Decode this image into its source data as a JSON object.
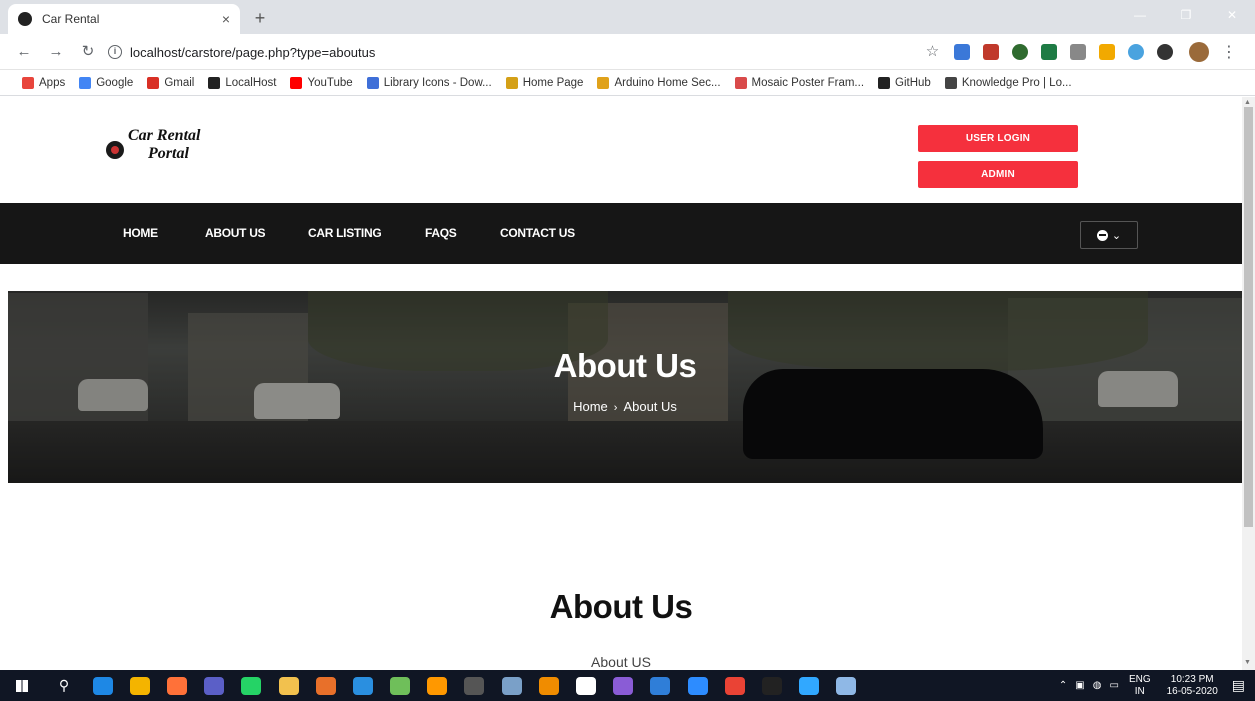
{
  "browser": {
    "tab_title": "Car Rental",
    "tab_close": "×",
    "new_tab": "+",
    "url": "localhost/carstore/page.php?type=aboutus",
    "bookmarks": [
      {
        "label": "Apps",
        "color": "#e8453c"
      },
      {
        "label": "Google",
        "color": "#4285f4"
      },
      {
        "label": "Gmail",
        "color": "#d93025"
      },
      {
        "label": "LocalHost",
        "color": "#222222"
      },
      {
        "label": "YouTube",
        "color": "#ff0000"
      },
      {
        "label": "Library Icons - Dow...",
        "color": "#3f6fd8"
      },
      {
        "label": "Home Page",
        "color": "#d4a017"
      },
      {
        "label": "Arduino Home Sec...",
        "color": "#e0a21b"
      },
      {
        "label": "Mosaic Poster Fram...",
        "color": "#d94a4a"
      },
      {
        "label": "GitHub",
        "color": "#222222"
      },
      {
        "label": "Knowledge Pro | Lo...",
        "color": "#444444"
      }
    ]
  },
  "site": {
    "logo_line1": "Car Rental",
    "logo_line2": "Portal",
    "user_login_label": "USER LOGIN",
    "admin_label": "ADMIN",
    "nav": {
      "home": "HOME",
      "about": "ABOUT US",
      "listing": "CAR LISTING",
      "faqs": "FAQS",
      "contact": "CONTACT US"
    },
    "user_menu_caret": "⌄"
  },
  "hero": {
    "title": "About Us",
    "crumb_home": "Home",
    "crumb_sep": "›",
    "crumb_current": "About Us"
  },
  "content": {
    "title": "About Us",
    "subtitle": "About US"
  },
  "taskbar": {
    "lang_top": "ENG",
    "lang_bottom": "IN",
    "time": "10:23 PM",
    "date": "16-05-2020",
    "apps": [
      {
        "name": "edge",
        "color": "#1e88e5"
      },
      {
        "name": "chrome",
        "color": "#f4b400"
      },
      {
        "name": "firefox",
        "color": "#ff7139"
      },
      {
        "name": "teams",
        "color": "#5b5fc7"
      },
      {
        "name": "whatsapp",
        "color": "#25d366"
      },
      {
        "name": "explorer",
        "color": "#f2c14e"
      },
      {
        "name": "app-orange",
        "color": "#e8702a"
      },
      {
        "name": "vscode",
        "color": "#2a8fe0"
      },
      {
        "name": "notepad",
        "color": "#6fbf5a"
      },
      {
        "name": "sublime",
        "color": "#ff9800"
      },
      {
        "name": "terminal",
        "color": "#555555"
      },
      {
        "name": "paint",
        "color": "#7aa0c8"
      },
      {
        "name": "app-orange2",
        "color": "#f08c00"
      },
      {
        "name": "github",
        "color": "#ffffff"
      },
      {
        "name": "app-purple",
        "color": "#8a5cd6"
      },
      {
        "name": "sourcetree",
        "color": "#2f7ed8"
      },
      {
        "name": "zoom",
        "color": "#2d8cff"
      },
      {
        "name": "gmail",
        "color": "#ea4335"
      },
      {
        "name": "app-black",
        "color": "#222222"
      },
      {
        "name": "photoshop",
        "color": "#31a8ff"
      },
      {
        "name": "word",
        "color": "#8fb8e6"
      }
    ]
  }
}
